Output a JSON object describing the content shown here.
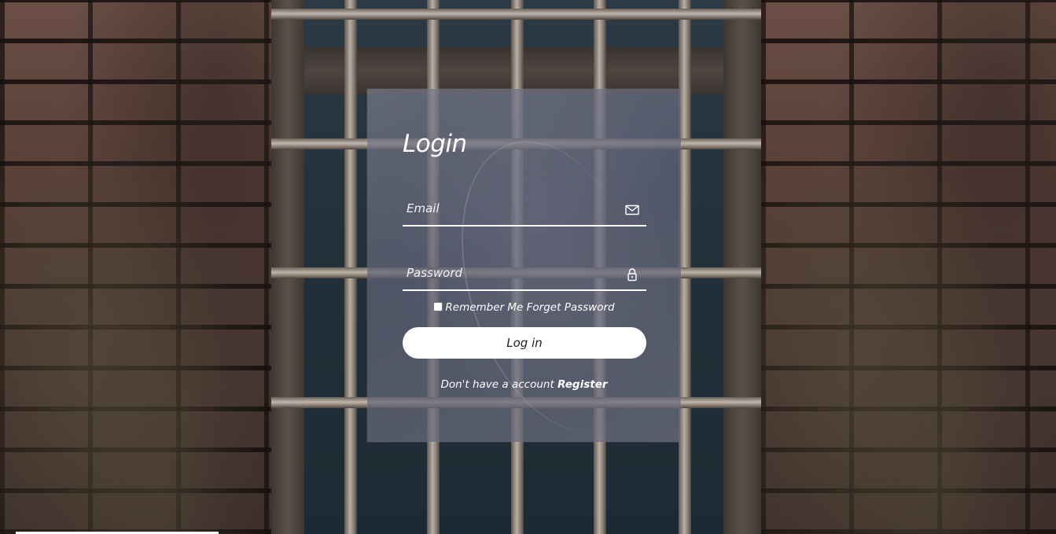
{
  "form": {
    "title": "Login",
    "email": {
      "placeholder": "Email",
      "value": "",
      "icon": "envelope-icon"
    },
    "password": {
      "placeholder": "Password",
      "value": "",
      "icon": "lock-icon"
    },
    "remember_label": "Remember Me",
    "forget_label": "Forget Password",
    "login_button": "Log in",
    "register_prompt": "Don't have a account",
    "register_link": "Register"
  },
  "colors": {
    "text": "#ffffff",
    "button_bg": "#ffffff",
    "button_text": "#1b1b22",
    "card_bg": "#6e7088"
  }
}
